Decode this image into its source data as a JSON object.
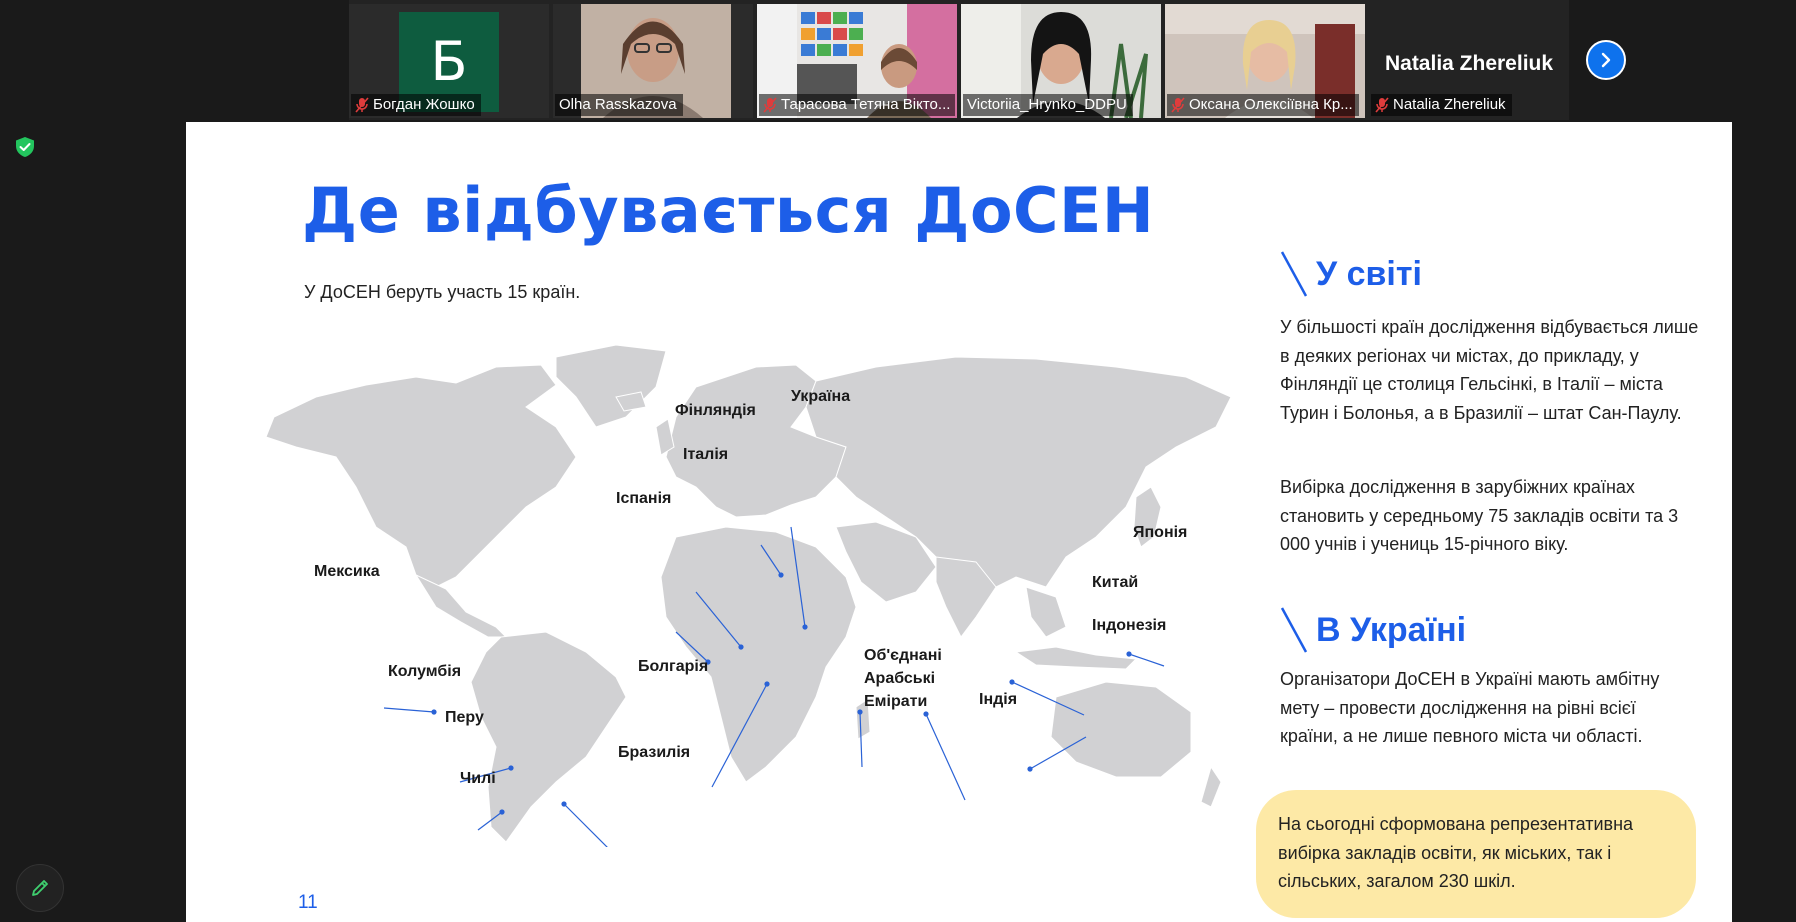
{
  "participants": [
    {
      "name": "Богдан Жошко",
      "avatar_letter": "Б",
      "muted": true
    },
    {
      "name": "Olha Rasskazova",
      "muted": false
    },
    {
      "name": "Тарасова Тетяна Вікто...",
      "muted": true
    },
    {
      "name": "Victoriia_Hrynko_DDPU",
      "muted": false,
      "active_speaker": true
    },
    {
      "name": "Оксана Олексіївна Кр...",
      "muted": true
    },
    {
      "name": "Natalia Zhereliuk",
      "title": "Natalia Zhereliuk",
      "muted": true
    }
  ],
  "slide": {
    "title": "Де відбувається ДоСЕН",
    "subtitle": "У ДоСЕН беруть участь 15 країн.",
    "page_number": "11",
    "map_labels": {
      "finland": "Фінляндія",
      "ukraine": "Україна",
      "italy": "Італія",
      "spain": "Іспанія",
      "japan": "Японія",
      "china": "Китай",
      "indonesia": "Індонезія",
      "mexico": "Мексика",
      "colombia": "Колумбія",
      "peru": "Перу",
      "chile": "Чилі",
      "brazil": "Бразилія",
      "bulgaria": "Болгарія",
      "uae": "Об'єднані\nАрабські\nЕмірати",
      "india": "Індія"
    },
    "world": {
      "heading": "У світі",
      "p1": "У більшості країн дослідження відбувається лише в деяких регіонах чи містах, до прикладу, у Фінляндії це столиця Гельсінкі, в Італії – міста Турин і Болонья, а в Бразилії – штат Сан-Паулу.",
      "p2": "Вибірка дослідження в зарубіжних країнах становить у середньому 75 закладів освіти та 3 000 учнів і учениць 15-річного віку."
    },
    "ukraine": {
      "heading": "В Україні",
      "p1": "Організатори ДоСЕН в Україні мають амбітну мету – провести дослідження на рівні всієї країни, а не лише певного міста чи області.",
      "callout": "На сьогодні сформована репрезентативна вибірка закладів освіти, як міських, так і сільських, загалом 230 шкіл."
    }
  },
  "colors": {
    "accent": "#1d5ee8",
    "map_land": "#d1d1d3",
    "callout_bg": "#fde9a6",
    "zoom_blue": "#0e72ed",
    "shield_green": "#23c55e"
  }
}
